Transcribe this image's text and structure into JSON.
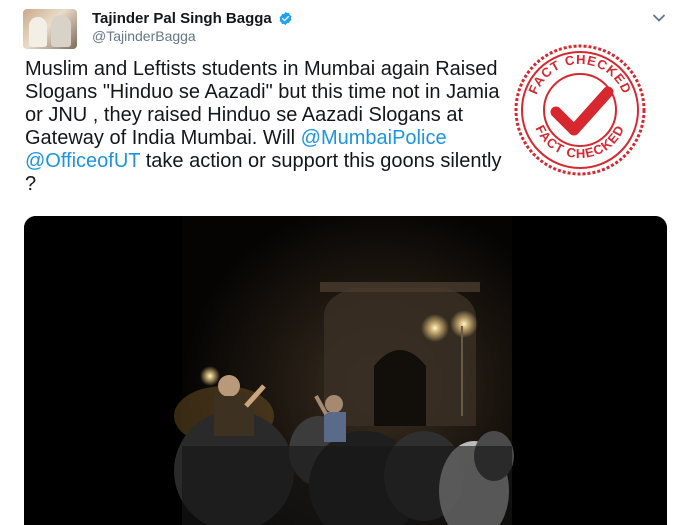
{
  "author": {
    "name": "Tajinder Pal Singh Bagga",
    "handle": "@TajinderBagga"
  },
  "icons": {
    "verified": "verified-badge-icon",
    "menu": "chevron-down-icon"
  },
  "tweet": {
    "lines": [
      "Muslim and Leftists students in Mumbai again Raised",
      "Slogans \"Hinduo se Aazadi\" but this time not in Jamia",
      "or JNU , they raised Hinduo se Aazadi Slogans at",
      "Gateway of India Mumbai. Will ",
      "@MumbaiPolice",
      "@OfficeofUT",
      " take action or support this goons silently",
      "?"
    ]
  },
  "stamp": {
    "top_text": "FACT CHECKED",
    "bottom_text": "FACT CHECKED"
  },
  "colors": {
    "link": "#1b95e0",
    "verified": "#1da1f2",
    "stamp": "#d7282f",
    "text": "#14171a",
    "secondary": "#657786"
  }
}
